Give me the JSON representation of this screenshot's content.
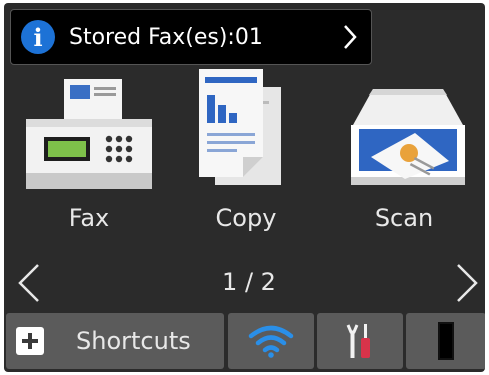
{
  "notification": {
    "text": "Stored Fax(es):01",
    "icon": "info-icon",
    "chevron": "chevron-right-icon"
  },
  "functions": [
    {
      "label": "Fax",
      "icon": "fax-machine-icon"
    },
    {
      "label": "Copy",
      "icon": "copy-documents-icon"
    },
    {
      "label": "Scan",
      "icon": "scanner-icon"
    }
  ],
  "pager": {
    "text": "1 / 2",
    "prev_icon": "chevron-left-icon",
    "next_icon": "chevron-right-icon"
  },
  "bottom_bar": {
    "shortcuts_label": "Shortcuts",
    "shortcuts_icon": "plus-icon",
    "wifi_icon": "wifi-icon",
    "tools_icon": "tools-icon",
    "ink_icon": "ink-level-icon"
  },
  "colors": {
    "background": "#2b2b2b",
    "button": "#5b5b5b",
    "info_blue": "#1d72d6",
    "wifi_blue": "#2a8fe8",
    "tool_red": "#d8334a"
  }
}
